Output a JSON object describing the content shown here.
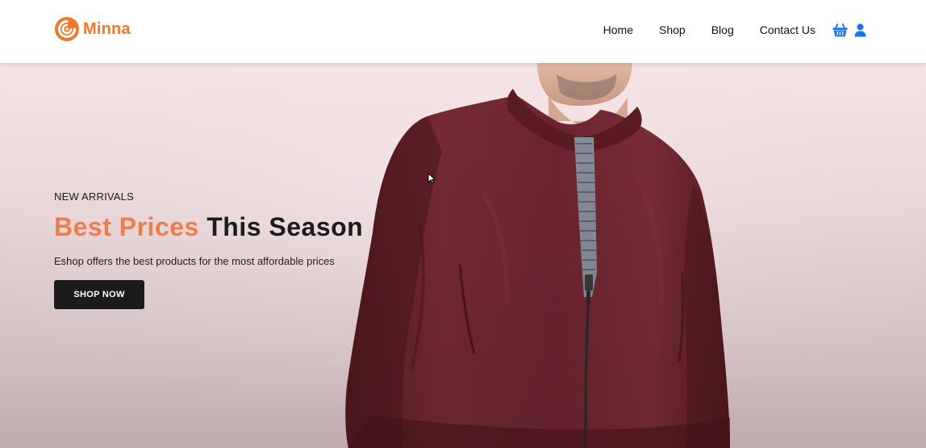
{
  "brand": {
    "name": "Minna",
    "accent_color": "#f0782a",
    "logo_icon": "swirl-icon"
  },
  "nav": {
    "items": [
      {
        "label": "Home"
      },
      {
        "label": "Shop"
      },
      {
        "label": "Blog"
      },
      {
        "label": "Contact Us"
      }
    ],
    "cart_icon": "basket-icon",
    "account_icon": "user-icon",
    "icon_color": "#1a73e8"
  },
  "hero": {
    "eyebrow": "NEW ARRIVALS",
    "headline_accent": "Best Prices",
    "headline_rest": "This Season",
    "headline_accent_color": "#f07c49",
    "subtext": "Eshop offers the best products for the most affordable prices",
    "cta_label": "SHOP NOW",
    "image": "man-in-burgundy-bomber-jacket"
  }
}
